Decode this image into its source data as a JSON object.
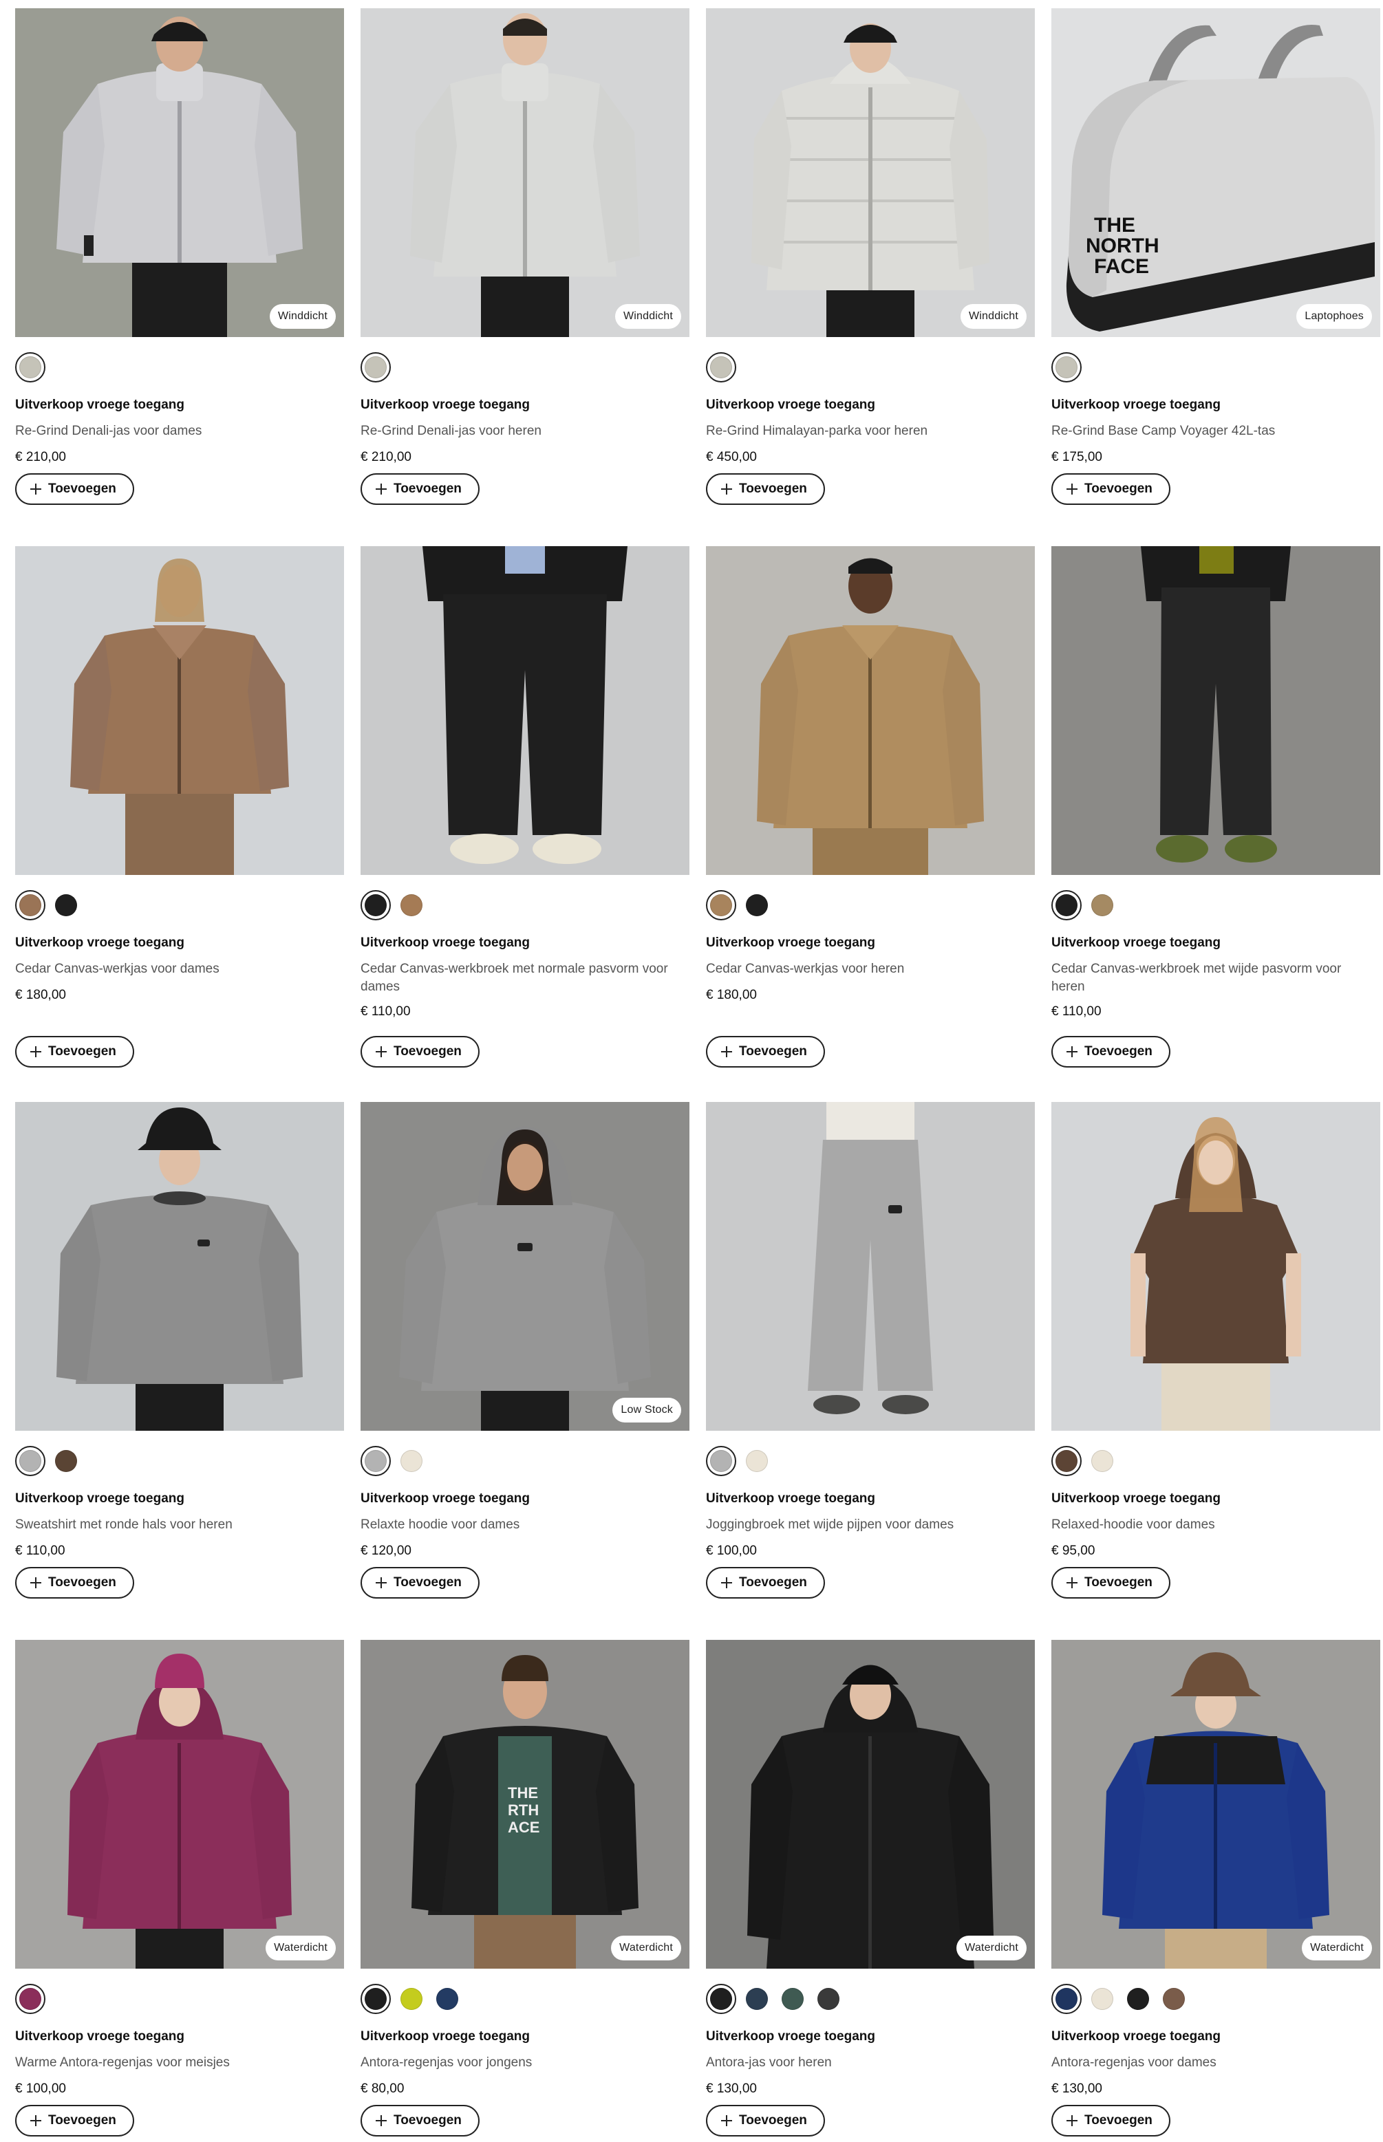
{
  "products": [
    {
      "badge": "Winddicht",
      "promo": "Uitverkoop vroege toegang",
      "name": "Re-Grind Denali-jas voor dames",
      "price": "€ 210,00",
      "add_label": "Toevoegen",
      "image": "woman-grey-fleece-jacket-black-cap",
      "background": "#9a9c93",
      "swatches": [
        "#c5c3b8"
      ]
    },
    {
      "badge": "Winddicht",
      "promo": "Uitverkoop vroege toegang",
      "name": "Re-Grind Denali-jas voor heren",
      "price": "€ 210,00",
      "add_label": "Toevoegen",
      "image": "man-light-grey-fleece-jacket",
      "background": "#d4d5d6",
      "swatches": [
        "#c5c3b8"
      ]
    },
    {
      "badge": "Winddicht",
      "promo": "Uitverkoop vroege toegang",
      "name": "Re-Grind Himalayan-parka voor heren",
      "price": "€ 450,00",
      "add_label": "Toevoegen",
      "image": "man-light-grey-puffer-parka-black-cap",
      "background": "#d4d5d6",
      "swatches": [
        "#c5c3b8"
      ]
    },
    {
      "badge": "Laptophoes",
      "promo": "Uitverkoop vroege toegang",
      "name": "Re-Grind Base Camp Voyager 42L-tas",
      "price": "€ 175,00",
      "add_label": "Toevoegen",
      "image": "light-grey-duffel-bag",
      "background": "#dfe0e1",
      "swatches": [
        "#c5c3b8"
      ]
    },
    {
      "badge": "",
      "promo": "Uitverkoop vroege toegang",
      "name": "Cedar Canvas-werkjas voor dames",
      "price": "€ 180,00",
      "add_label": "Toevoegen",
      "image": "woman-brown-canvas-work-jacket",
      "background": "#d1d4d7",
      "swatches": [
        "#9a7456",
        "#1f1f1f"
      ]
    },
    {
      "badge": "",
      "promo": "Uitverkoop vroege toegang",
      "name": "Cedar Canvas-werkbroek met normale pasvorm voor dames",
      "price": "€ 110,00",
      "add_label": "Toevoegen",
      "image": "black-canvas-work-trousers",
      "background": "#c9cacb",
      "swatches": [
        "#1f1f1f",
        "#a57b55"
      ]
    },
    {
      "badge": "",
      "promo": "Uitverkoop vroege toegang",
      "name": "Cedar Canvas-werkjas voor heren",
      "price": "€ 180,00",
      "add_label": "Toevoegen",
      "image": "man-tan-canvas-work-jacket",
      "background": "#bcbab5",
      "swatches": [
        "#a8845d",
        "#1f1f1f"
      ]
    },
    {
      "badge": "",
      "promo": "Uitverkoop vroege toegang",
      "name": "Cedar Canvas-werkbroek met wijde pasvorm voor heren",
      "price": "€ 110,00",
      "add_label": "Toevoegen",
      "image": "black-wide-canvas-work-trousers",
      "background": "#8b8a87",
      "swatches": [
        "#1f1f1f",
        "#a58a63"
      ]
    },
    {
      "badge": "",
      "promo": "Uitverkoop vroege toegang",
      "name": "Sweatshirt met ronde hals voor heren",
      "price": "€ 110,00",
      "add_label": "Toevoegen",
      "image": "man-grey-crew-sweatshirt-bucket-hat",
      "background": "#c8cbcd",
      "swatches": [
        "#b3b3b3",
        "#5a4434"
      ]
    },
    {
      "badge": "Low Stock",
      "promo": "Uitverkoop vroege toegang",
      "name": "Relaxte hoodie voor dames",
      "price": "€ 120,00",
      "add_label": "Toevoegen",
      "image": "woman-grey-hoodie",
      "background": "#8c8c8a",
      "swatches": [
        "#b3b3b3",
        "#ebe4d6"
      ]
    },
    {
      "badge": "",
      "promo": "Uitverkoop vroege toegang",
      "name": "Joggingbroek met wijde pijpen voor dames",
      "price": "€ 100,00",
      "add_label": "Toevoegen",
      "image": "grey-wide-leg-joggers",
      "background": "#c9cacb",
      "swatches": [
        "#b3b3b3",
        "#ebe4d6"
      ]
    },
    {
      "badge": "",
      "promo": "Uitverkoop vroege toegang",
      "name": "Relaxed-hoodie voor dames",
      "price": "€ 95,00",
      "add_label": "Toevoegen",
      "image": "woman-brown-sleeveless-hoodie",
      "background": "#d4d6d8",
      "swatches": [
        "#5c4435",
        "#ebe4d6"
      ]
    },
    {
      "badge": "Waterdicht",
      "promo": "Uitverkoop vroege toegang",
      "name": "Warme Antora-regenjas voor meisjes",
      "price": "€ 100,00",
      "add_label": "Toevoegen",
      "image": "girl-magenta-rain-jacket-beanie",
      "background": "#a5a4a2",
      "swatches": [
        "#8b2e5a"
      ]
    },
    {
      "badge": "Waterdicht",
      "promo": "Uitverkoop vroege toegang",
      "name": "Antora-regenjas voor jongens",
      "price": "€ 80,00",
      "add_label": "Toevoegen",
      "image": "boy-black-rain-jacket",
      "background": "#8e8d8b",
      "swatches": [
        "#1f1f1f",
        "#c4cc1e",
        "#233b63"
      ]
    },
    {
      "badge": "Waterdicht",
      "promo": "Uitverkoop vroege toegang",
      "name": "Antora-jas voor heren",
      "price": "€ 130,00",
      "add_label": "Toevoegen",
      "image": "man-black-rain-jacket-black-cap",
      "background": "#7e7e7c",
      "swatches": [
        "#1f1f1f",
        "#2c3e52",
        "#3f5a52",
        "#3a3a3a"
      ]
    },
    {
      "badge": "Waterdicht",
      "promo": "Uitverkoop vroege toegang",
      "name": "Antora-regenjas voor dames",
      "price": "€ 130,00",
      "add_label": "Toevoegen",
      "image": "woman-blue-rain-jacket-bucket-hat",
      "background": "#9e9d9a",
      "swatches": [
        "#1f3560",
        "#ebe4d6",
        "#1f1f1f",
        "#7a5c4a"
      ]
    }
  ]
}
